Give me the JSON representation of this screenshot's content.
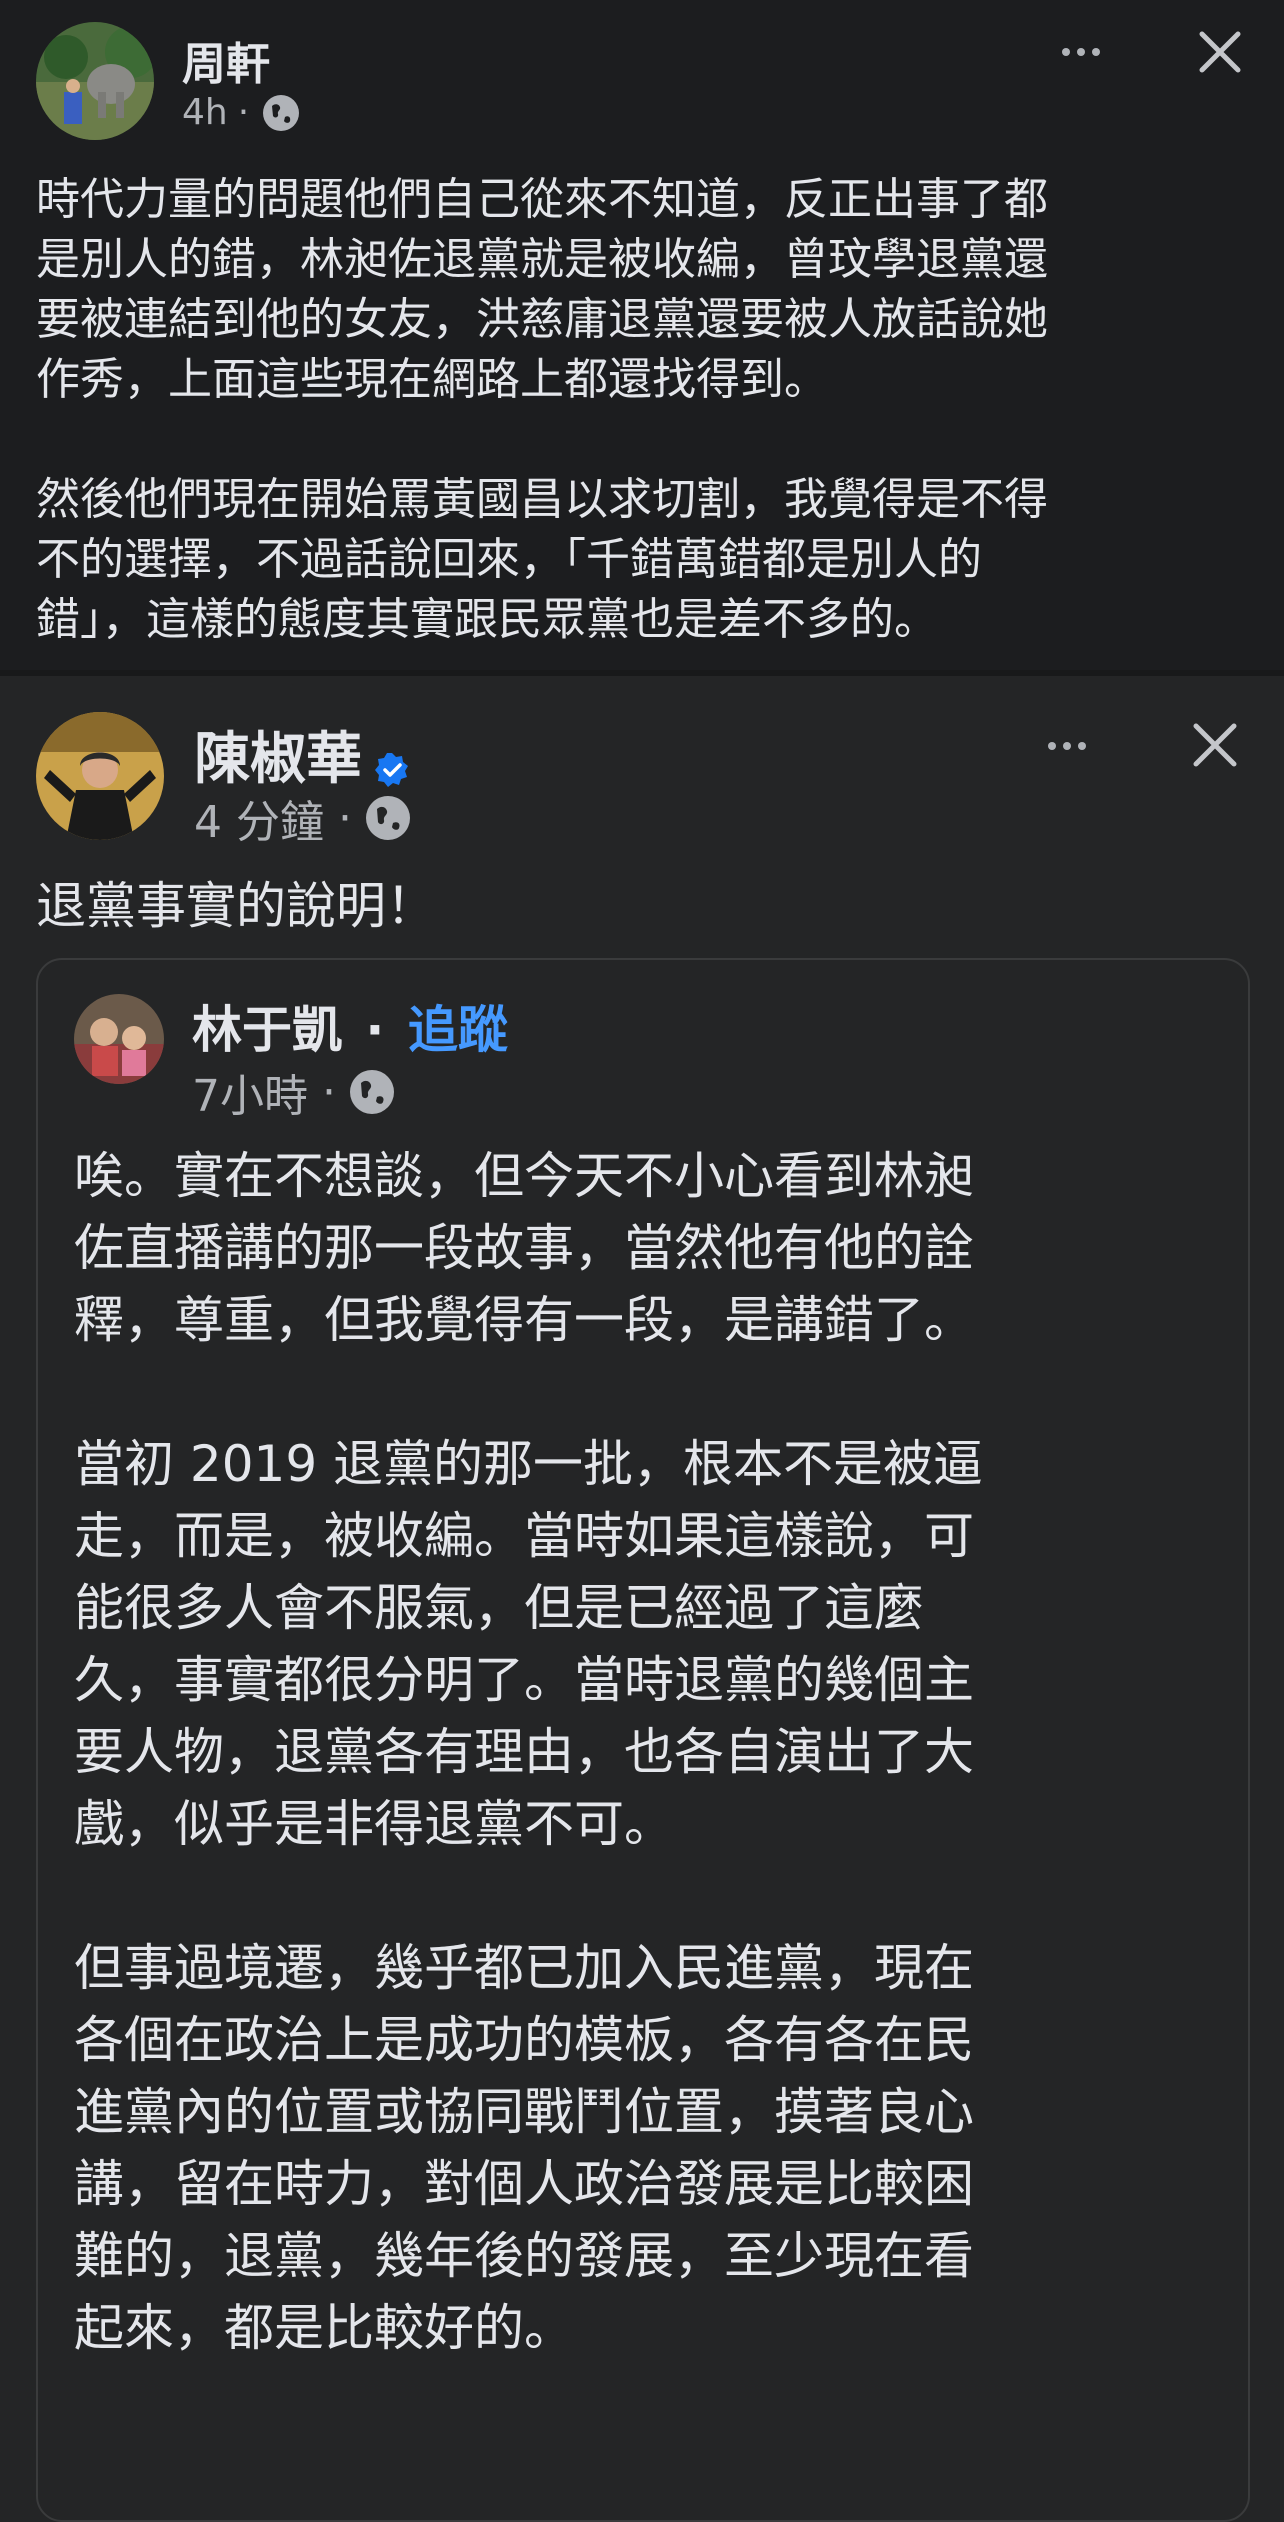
{
  "post1": {
    "author": "周軒",
    "time": "4h",
    "separator": "·",
    "globe_icon": "globe-icon",
    "more_icon": "more-dots-icon",
    "close_icon": "close-x-icon",
    "text": "時代力量的問題他們自己從來不知道，反正出事了都\n是別人的錯，林昶佐退黨就是被收編，曾玟學退黨還\n要被連結到他的女友，洪慈庸退黨還要被人放話說她\n作秀，上面這些現在網路上都還找得到。\n\n然後他們現在開始罵黃國昌以求切割，我覺得是不得\n不的選擇，不過話說回來，「千錯萬錯都是別人的\n錯」，這樣的態度其實跟民眾黨也是差不多的。"
  },
  "post2": {
    "author": "陳椒華",
    "verified_icon": "verified-badge-icon",
    "time": "4 分鐘",
    "separator": "·",
    "text": "退黨事實的說明！",
    "shared": {
      "author": "林于凱",
      "dot": "·",
      "follow_label": "追蹤",
      "time": "7小時",
      "separator": "·",
      "text": "唉。實在不想談，但今天不小心看到林昶\n佐直播講的那一段故事，當然他有他的詮\n釋，尊重，但我覺得有一段，是講錯了。\n\n當初 2019 退黨的那一批，根本不是被逼\n走，而是，被收編。當時如果這樣說，可\n能很多人會不服氣，但是已經過了這麼\n久，事實都很分明了。當時退黨的幾個主\n要人物，退黨各有理由，也各自演出了大\n戲，似乎是非得退黨不可。\n\n但事過境遷，幾乎都已加入民進黨，現在\n各個在政治上是成功的模板，各有各在民\n進黨內的位置或協同戰鬥位置，摸著良心\n講，留在時力，對個人政治發展是比較困\n難的，退黨，幾年後的發展，至少現在看\n起來，都是比較好的。"
    }
  },
  "colors": {
    "background": "#242526",
    "text": "#e4e6eb",
    "secondary": "#b0b3b8",
    "link_blue": "#4599ff",
    "verified_blue": "#1877f2"
  }
}
